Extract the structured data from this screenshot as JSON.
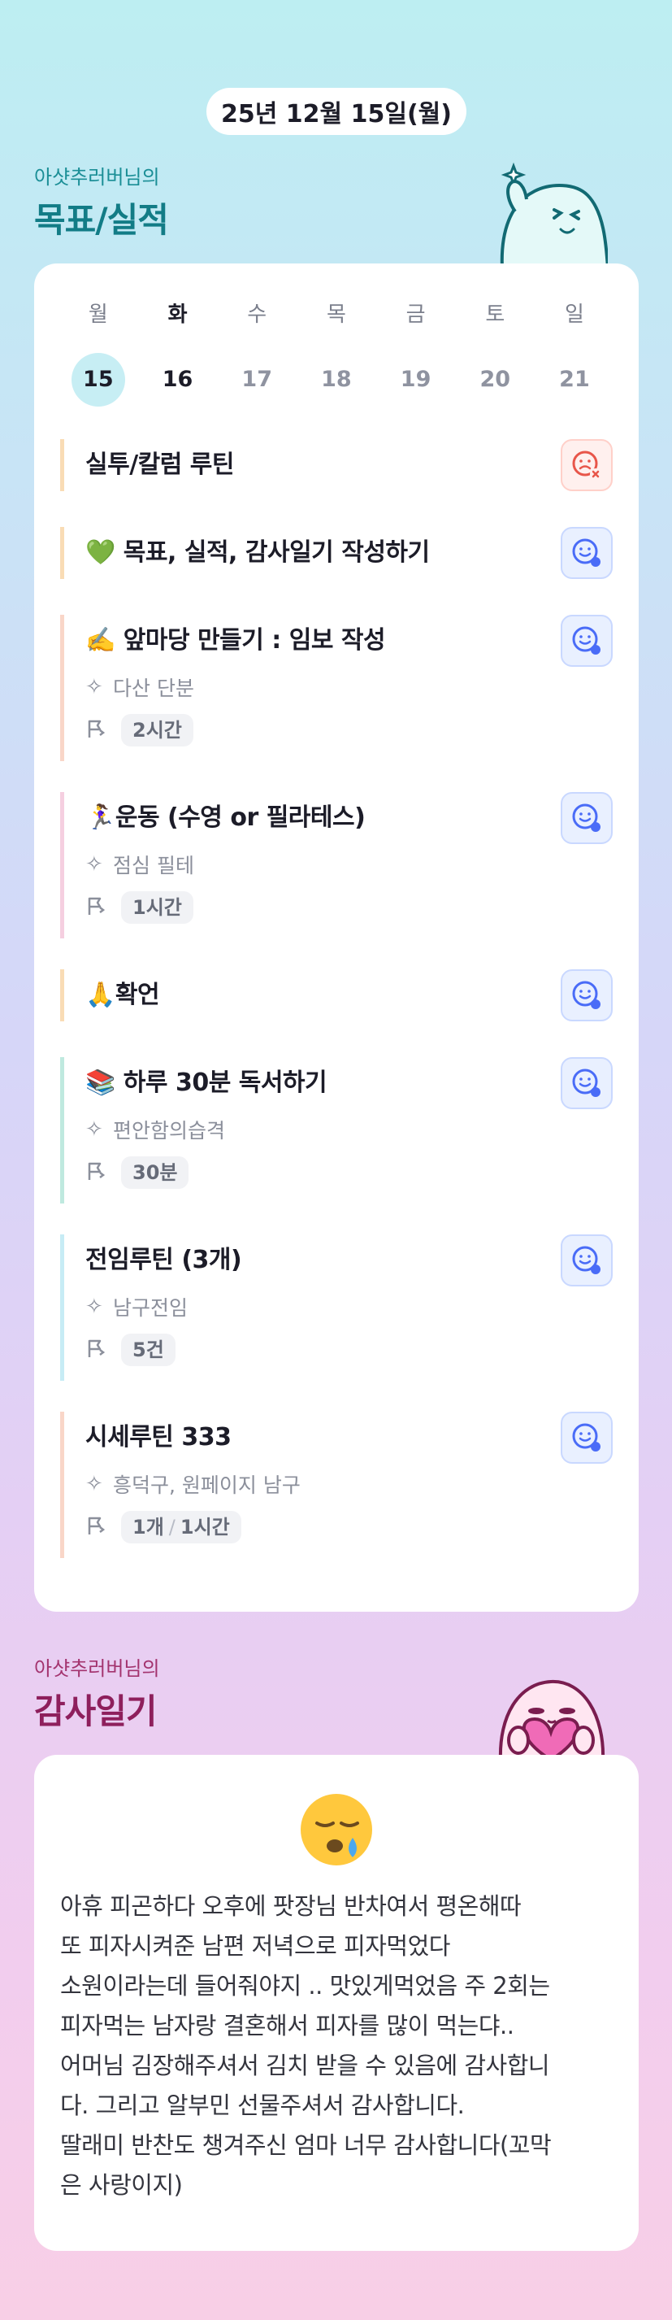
{
  "header": {
    "date": "25년 12월 15일(월)"
  },
  "goals_section": {
    "subtitle": "아샷추러버님의",
    "title": "목표/실적"
  },
  "week": {
    "days": [
      "월",
      "화",
      "수",
      "목",
      "금",
      "토",
      "일"
    ],
    "dates": [
      "15",
      "16",
      "17",
      "18",
      "19",
      "20",
      "21"
    ],
    "today_index": 0,
    "selected_index": 1
  },
  "goals": [
    {
      "title": "실투/칼럼 루틴",
      "status": "fail",
      "color": "#f9dcb5"
    },
    {
      "title": "💚 목표, 실적, 감사일기 작성하기",
      "status": "ok",
      "color": "#f9dcb5"
    },
    {
      "title": "✍️ 앞마당 만들기 : 임보 작성",
      "meta": "다산 단분",
      "chip": "2시간",
      "status": "ok",
      "color": "#f9d6c8"
    },
    {
      "title": "🏃‍♀️운동 (수영 or 필라테스)",
      "meta": "점심 필테",
      "chip": "1시간",
      "status": "ok",
      "color": "#f5cfe0"
    },
    {
      "title": "🙏확언",
      "status": "ok",
      "color": "#f9dcb5"
    },
    {
      "title": "📚 하루 30분 독서하기",
      "meta": "편안함의습격",
      "chip": "30분",
      "status": "ok",
      "color": "#bfe9df"
    },
    {
      "title": "전임루틴 (3개)",
      "meta": "남구전임",
      "chip": "5건",
      "status": "ok",
      "color": "#c7ecf5"
    },
    {
      "title": "시세루틴 333",
      "meta": "흥덕구, 원페이지 남구",
      "chip_a": "1개",
      "chip_sep": "/",
      "chip_b": "1시간",
      "status": "ok",
      "color": "#f9d6c8"
    }
  ],
  "thanks_section": {
    "subtitle": "아샷추러버님의",
    "title": "감사일기"
  },
  "diary": {
    "mood_icon": "sleepy-face-icon",
    "lines": [
      "아휴 피곤하다 오후에 팟장님 반차여서 평온해따",
      "또 피자시켜준 남편 저녁으로 피자먹었다",
      "소원이라는데 들어줘야지 .. 맛있게먹었음 주 2회는",
      "피자먹는 남자랑 결혼해서 피자를 많이 먹는댜..",
      "어머님 김장해주셔서 김치 받을 수 있음에 감사합니",
      "다. 그리고 알부민 선물주셔서 감사합니다.",
      "딸래미 반찬도 챙겨주신 엄마 너무 감사합니다(꼬막",
      "은 사랑이지)"
    ]
  },
  "colors": {
    "accent_teal": "#127c86",
    "accent_pink": "#8e1f5c",
    "ok_blue": "#4a6cf7",
    "fail_red": "#e8564a"
  }
}
